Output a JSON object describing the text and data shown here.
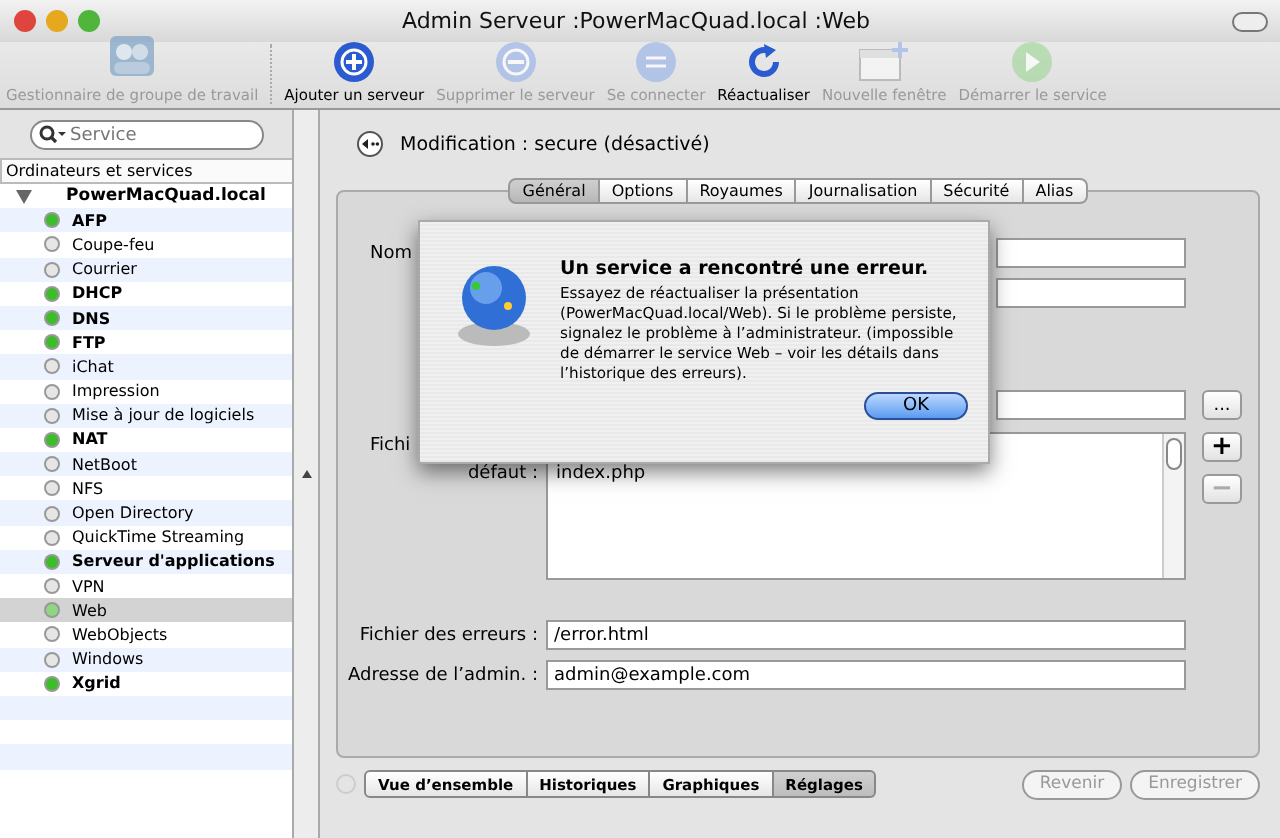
{
  "window": {
    "title": "Admin Serveur :PowerMacQuad.local :Web"
  },
  "toolbar": [
    {
      "label": "Gestionnaire de groupe de travail",
      "disabled": true,
      "kind": "workgroup"
    },
    {
      "label": "Ajouter un serveur",
      "disabled": false,
      "kind": "add"
    },
    {
      "label": "Supprimer le serveur",
      "disabled": true,
      "kind": "remove"
    },
    {
      "label": "Se connecter",
      "disabled": true,
      "kind": "connect"
    },
    {
      "label": "Réactualiser",
      "disabled": false,
      "kind": "refresh"
    },
    {
      "label": "Nouvelle fenêtre",
      "disabled": true,
      "kind": "window"
    },
    {
      "label": "Démarrer le service",
      "disabled": true,
      "kind": "start"
    }
  ],
  "sidebar": {
    "search": {
      "placeholder": "Service"
    },
    "header": "Ordinateurs et services",
    "server": {
      "name": "PowerMacQuad.local",
      "expanded": true,
      "children": [
        {
          "name": "AFP",
          "running": true,
          "color": "#3ebd2a",
          "selected": false
        },
        {
          "name": "Coupe-feu",
          "running": false,
          "color": "#e6e6e6",
          "selected": false
        },
        {
          "name": "Courrier",
          "running": false,
          "color": "#e6e6e6",
          "selected": false
        },
        {
          "name": "DHCP",
          "running": true,
          "color": "#3ebd2a",
          "selected": false
        },
        {
          "name": "DNS",
          "running": true,
          "color": "#3ebd2a",
          "selected": false
        },
        {
          "name": "FTP",
          "running": true,
          "color": "#3ebd2a",
          "selected": false
        },
        {
          "name": "iChat",
          "running": false,
          "color": "#e6e6e6",
          "selected": false
        },
        {
          "name": "Impression",
          "running": false,
          "color": "#e6e6e6",
          "selected": false
        },
        {
          "name": "Mise à jour de logiciels",
          "running": false,
          "color": "#e6e6e6",
          "selected": false
        },
        {
          "name": "NAT",
          "running": true,
          "color": "#3ebd2a",
          "selected": false
        },
        {
          "name": "NetBoot",
          "running": false,
          "color": "#e6e6e6",
          "selected": false
        },
        {
          "name": "NFS",
          "running": false,
          "color": "#e6e6e6",
          "selected": false
        },
        {
          "name": "Open Directory",
          "running": false,
          "color": "#e6e6e6",
          "selected": false
        },
        {
          "name": "QuickTime Streaming",
          "running": false,
          "color": "#e6e6e6",
          "selected": false
        },
        {
          "name": "Serveur d'applications",
          "running": true,
          "color": "#3ebd2a",
          "selected": false
        },
        {
          "name": "VPN",
          "running": false,
          "color": "#e6e6e6",
          "selected": false
        },
        {
          "name": "Web",
          "running": false,
          "color": "#8fd680",
          "selected": true
        },
        {
          "name": "WebObjects",
          "running": false,
          "color": "#e6e6e6",
          "selected": false
        },
        {
          "name": "Windows",
          "running": false,
          "color": "#e6e6e6",
          "selected": false
        },
        {
          "name": "Xgrid",
          "running": true,
          "color": "#3ebd2a",
          "selected": false
        }
      ]
    }
  },
  "editor": {
    "heading": "Modification :  secure (désactivé)",
    "tabs": [
      {
        "label": "Général",
        "selected": true
      },
      {
        "label": "Options",
        "selected": false
      },
      {
        "label": "Royaumes",
        "selected": false
      },
      {
        "label": "Journalisation",
        "selected": false
      },
      {
        "label": "Sécurité",
        "selected": false
      },
      {
        "label": "Alias",
        "selected": false
      }
    ],
    "labels": {
      "name": "Nom",
      "default_file_1": "Fichi",
      "default_file_2": "défaut :"
    },
    "default_files": [
      "index.php"
    ],
    "error_file": {
      "label": "Fichier des erreurs :",
      "value": "/error.html"
    },
    "admin_address": {
      "label": "Adresse de l’admin. :",
      "value": "admin@example.com"
    },
    "browse_button": "...",
    "add_button": "+",
    "remove_button": "−"
  },
  "bottom": {
    "tabs": [
      {
        "label": "Vue d’ensemble",
        "selected": false
      },
      {
        "label": "Historiques",
        "selected": false
      },
      {
        "label": "Graphiques",
        "selected": false
      },
      {
        "label": "Réglages",
        "selected": true
      }
    ],
    "buttons": [
      {
        "label": "Revenir",
        "disabled": true
      },
      {
        "label": "Enregistrer",
        "disabled": true
      }
    ]
  },
  "dialog": {
    "title": "Un service a rencontré une erreur.",
    "message": "Essayez de réactualiser la présentation (PowerMacQuad.local/Web). Si le problème persiste, signalez le problème à l’administrateur. (impossible de démarrer le service Web – voir les détails dans l’historique des erreurs).",
    "button": "OK"
  }
}
